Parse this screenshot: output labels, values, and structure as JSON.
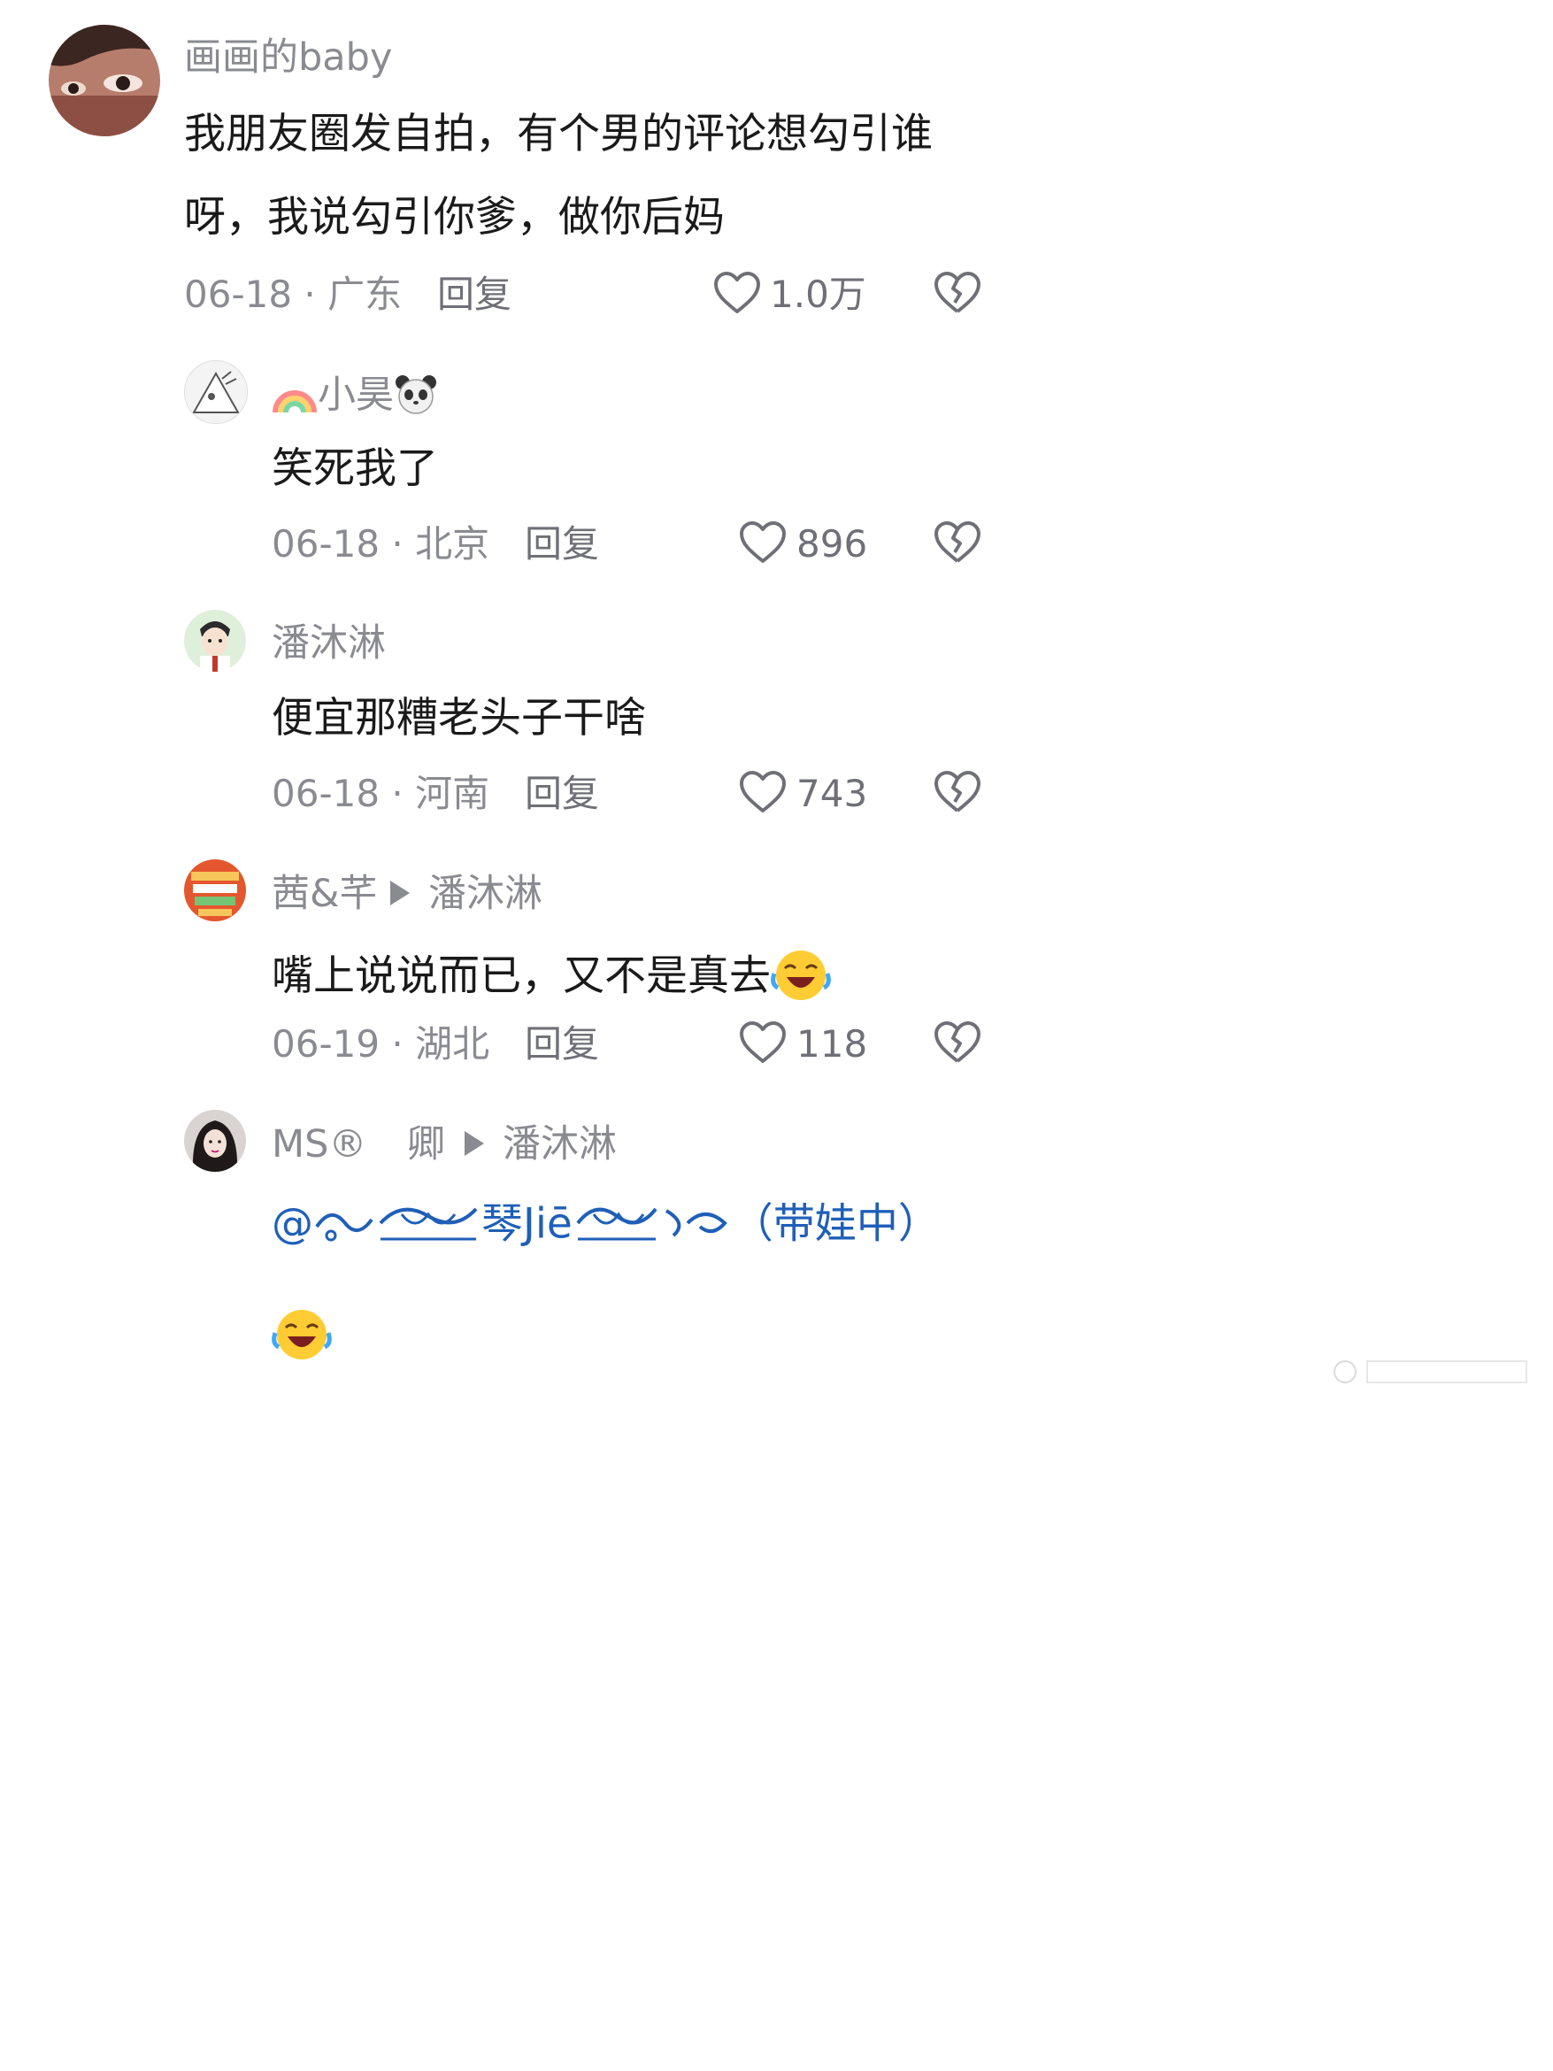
{
  "comments": [
    {
      "username": "画画的baby",
      "text_line1": "我朋友圈发自拍，有个男的评论想勾引谁",
      "text_line2": "呀，我说勾引你爹，做你后妈",
      "date_location": "06-18 · 广东",
      "reply_label": "回复",
      "likes": "1.0万"
    },
    {
      "username": "小昊",
      "text": "笑死我了",
      "date_location": "06-18 · 北京",
      "reply_label": "回复",
      "likes": "896"
    },
    {
      "username": "潘沐淋",
      "text": "便宜那糟老头子干啥",
      "date_location": "06-18 · 河南",
      "reply_label": "回复",
      "likes": "743"
    },
    {
      "username": "茜&芊",
      "reply_to": "潘沐淋",
      "text": "嘴上说说而已，又不是真去",
      "date_location": "06-19 · 湖北",
      "reply_label": "回复",
      "likes": "118"
    },
    {
      "username": "MS®",
      "username_suffix": "卿",
      "reply_to": "潘沐淋",
      "mention_prefix": "@",
      "mention_main": "琴Jiē",
      "mention_suffix": "（带娃中）"
    }
  ],
  "icons": {
    "like": "heart-outline-icon",
    "dislike": "broken-heart-icon",
    "reply_arrow": "triangle-right-icon",
    "emoji": "rolling-laughing-emoji",
    "rainbow": "rainbow-emoji",
    "panda": "panda-emoji"
  },
  "colors": {
    "text": "#1a1a1a",
    "meta": "#8a8b91",
    "mention": "#1f5fb8"
  }
}
